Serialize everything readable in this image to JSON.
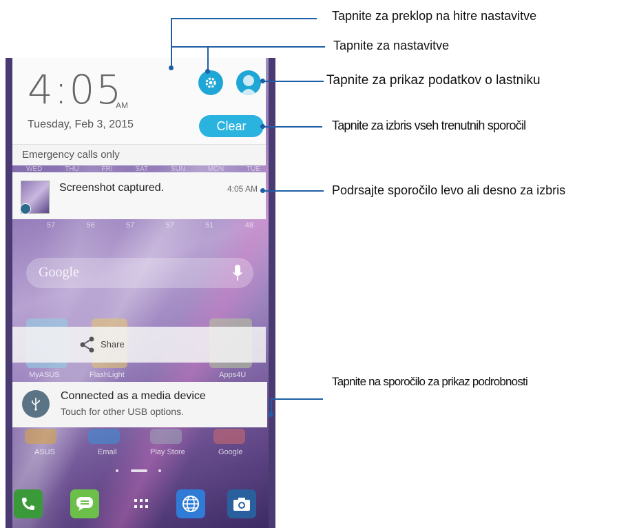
{
  "status": {
    "time": "4:05",
    "ampm": "AM",
    "date": "Tuesday, Feb 3, 2015",
    "emergency": "Emergency calls only"
  },
  "quick_settings": {
    "clear_label": "Clear",
    "settings_icon": "gear-icon",
    "owner_icon": "user-avatar-icon"
  },
  "notifications": [
    {
      "title": "Screenshot captured.",
      "time": "4:05 AM"
    },
    {
      "title": "Connected as a media device",
      "subtitle": "Touch for other USB options."
    }
  ],
  "background": {
    "days": [
      "WED",
      "THU",
      "FRI",
      "SAT",
      "SUN",
      "MON",
      "TUE"
    ],
    "temps": [
      "57",
      "56",
      "57",
      "57",
      "51",
      "48"
    ],
    "search_placeholder": "Google",
    "share_label": "Share",
    "row1_apps": [
      "MyASUS",
      "FlashLight",
      "Apps4U"
    ],
    "row2_apps": [
      "ASUS",
      "Email",
      "Play Store",
      "Google"
    ]
  },
  "callouts": {
    "quick_toggle": "Tapnite za preklop na hitre nastavitve",
    "settings": "Tapnite za nastavitve",
    "owner_info": "Tapnite za prikaz podatkov o lastniku",
    "clear_all": "Tapnite za izbris vseh trenutnih sporočil",
    "swipe": "Podrsajte sporočilo levo ali desno za izbris",
    "details": "Tapnite na sporočilo za prikaz podrobnosti"
  },
  "colors": {
    "accent": "#1ea7d6",
    "callout_line": "#1d5ea6"
  }
}
